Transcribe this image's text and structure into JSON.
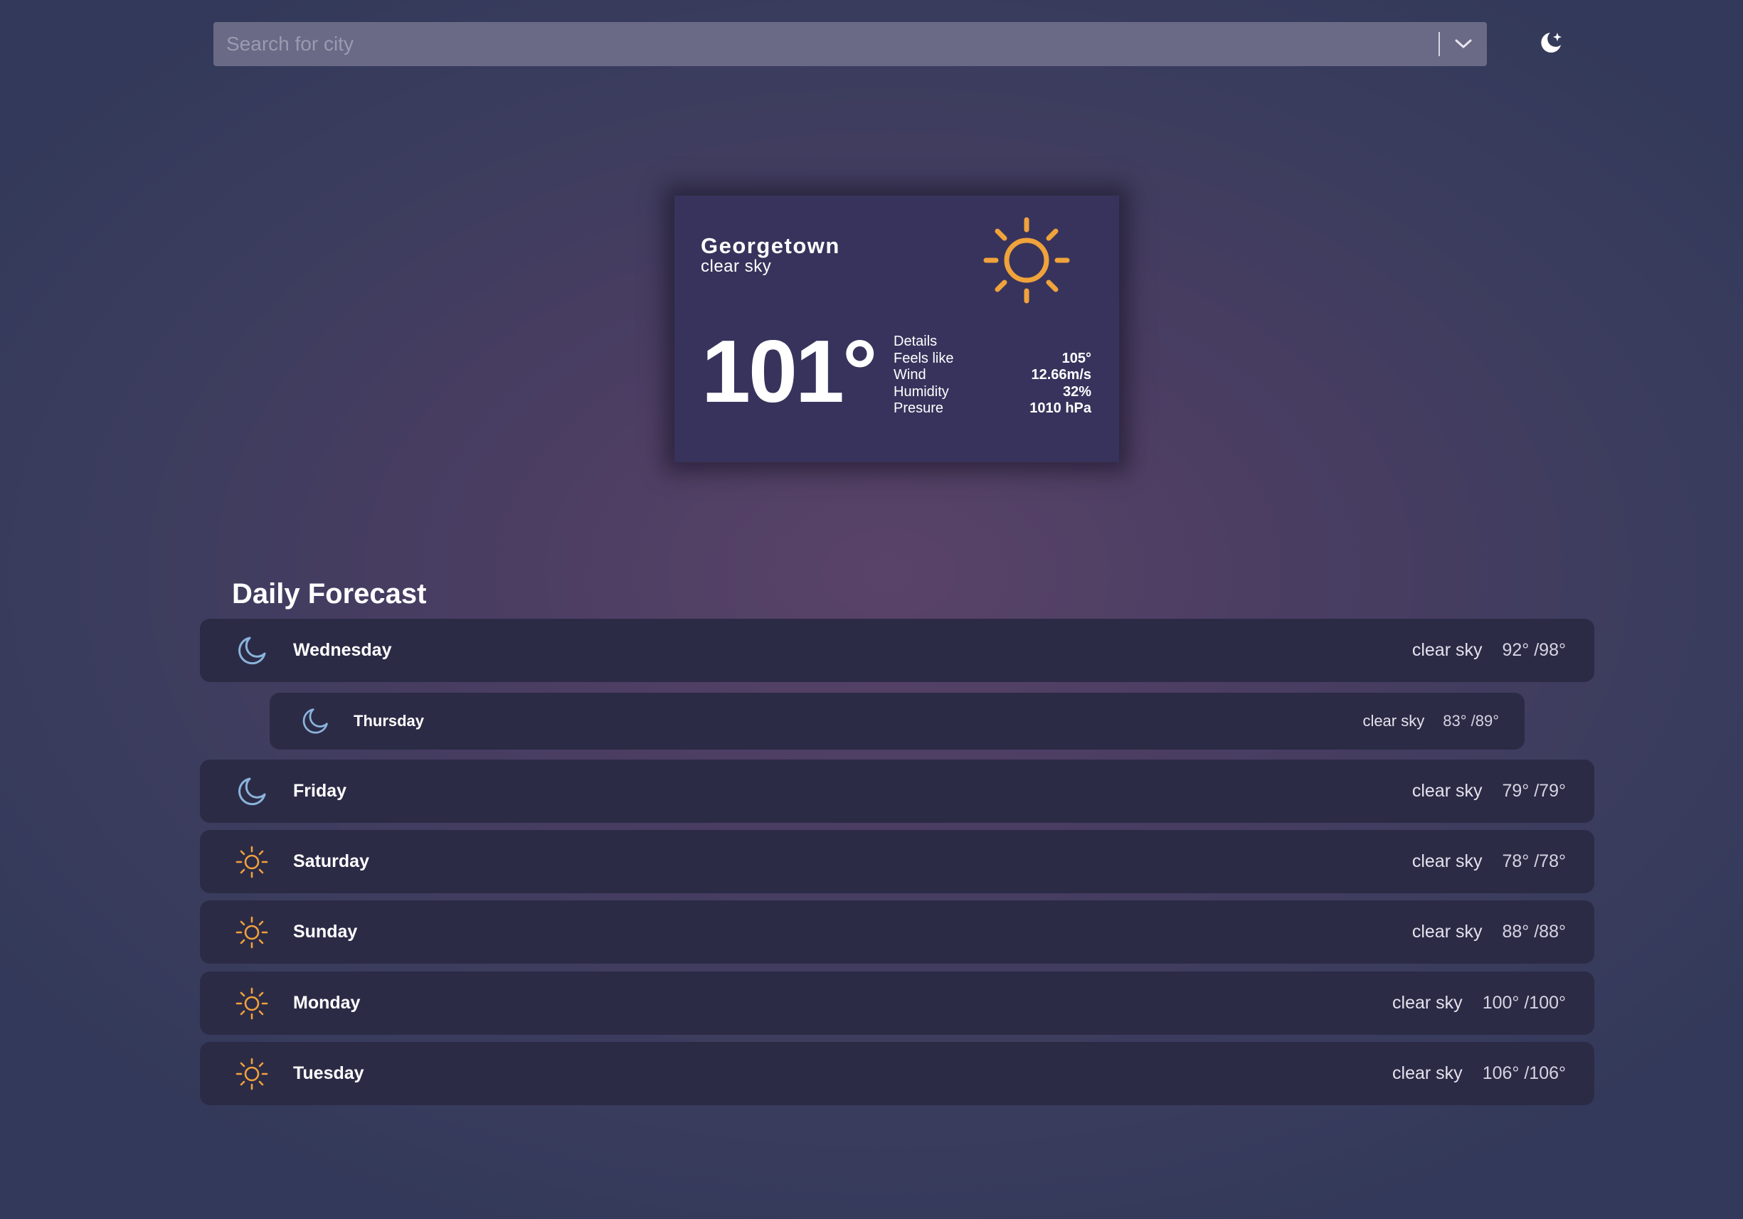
{
  "search": {
    "placeholder": "Search for city"
  },
  "icons": {
    "theme_toggle": "moon-star-icon",
    "dropdown": "chevron-down-icon",
    "current_condition": "sun-icon",
    "accent_sun": "#f0a23b",
    "accent_moon": "#8ab4dc"
  },
  "current": {
    "city": "Georgetown",
    "description": "clear sky",
    "temperature": "101°",
    "details_label": "Details",
    "details": [
      {
        "label": "Feels like",
        "value": "105°"
      },
      {
        "label": "Wind",
        "value": "12.66m/s"
      },
      {
        "label": "Humidity",
        "value": "32%"
      },
      {
        "label": "Presure",
        "value": "1010 hPa"
      }
    ]
  },
  "forecast": {
    "title": "Daily Forecast",
    "days": [
      {
        "day": "Wednesday",
        "icon": "moon-icon",
        "description": "clear sky",
        "temps": "92° /98°"
      },
      {
        "day": "Thursday",
        "icon": "moon-icon",
        "description": "clear sky",
        "temps": "83° /89°"
      },
      {
        "day": "Friday",
        "icon": "moon-icon",
        "description": "clear sky",
        "temps": "79° /79°"
      },
      {
        "day": "Saturday",
        "icon": "sun-icon",
        "description": "clear sky",
        "temps": "78° /78°"
      },
      {
        "day": "Sunday",
        "icon": "sun-icon",
        "description": "clear sky",
        "temps": "88° /88°"
      },
      {
        "day": "Monday",
        "icon": "sun-icon",
        "description": "clear sky",
        "temps": "100° /100°"
      },
      {
        "day": "Tuesday",
        "icon": "sun-icon",
        "description": "clear sky",
        "temps": "106° /106°"
      }
    ]
  }
}
